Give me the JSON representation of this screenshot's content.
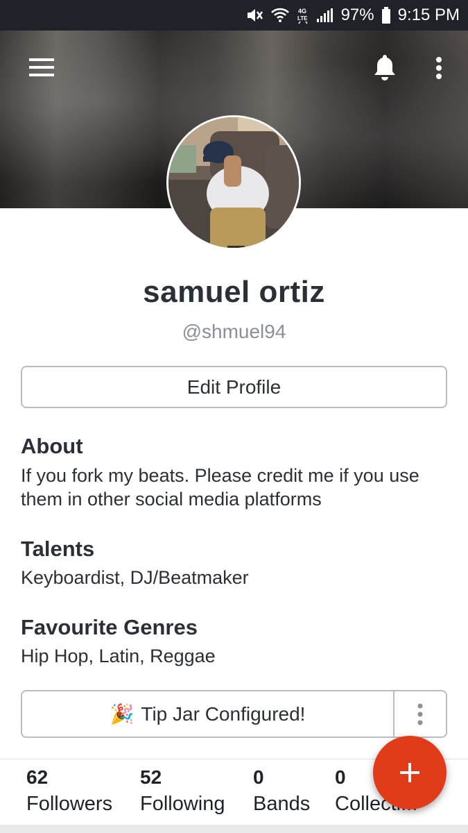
{
  "status_bar": {
    "battery": "97%",
    "time": "9:15 PM",
    "network": "4G LTE",
    "icons": [
      "mute-icon",
      "wifi-icon",
      "lte-icon",
      "signal-icon",
      "battery-icon"
    ]
  },
  "header": {
    "menu_icon": "hamburger-menu-icon",
    "notifications_icon": "bell-icon",
    "more_icon": "vertical-dots-icon"
  },
  "profile": {
    "name": "samuel ortiz",
    "handle": "@shmuel94",
    "edit_label": "Edit Profile"
  },
  "about": {
    "title": "About",
    "text": "If you fork my beats. Please credit me if you use them in other social media platforms"
  },
  "talents": {
    "title": "Talents",
    "text": "Keyboardist, DJ/Beatmaker"
  },
  "genres": {
    "title": "Favourite Genres",
    "text": "Hip Hop, Latin, Reggae"
  },
  "tip_jar": {
    "emoji": "🎉",
    "label": "Tip Jar Configured!"
  },
  "stats": [
    {
      "count": "62",
      "label": "Followers"
    },
    {
      "count": "52",
      "label": "Following"
    },
    {
      "count": "0",
      "label": "Bands"
    },
    {
      "count": "0",
      "label": "Collecti..."
    }
  ],
  "fab": {
    "icon": "plus-icon"
  },
  "colors": {
    "accent": "#e23b19",
    "text": "#2b2f36",
    "muted": "#8a8f98",
    "status_bar": "#1f2329"
  }
}
